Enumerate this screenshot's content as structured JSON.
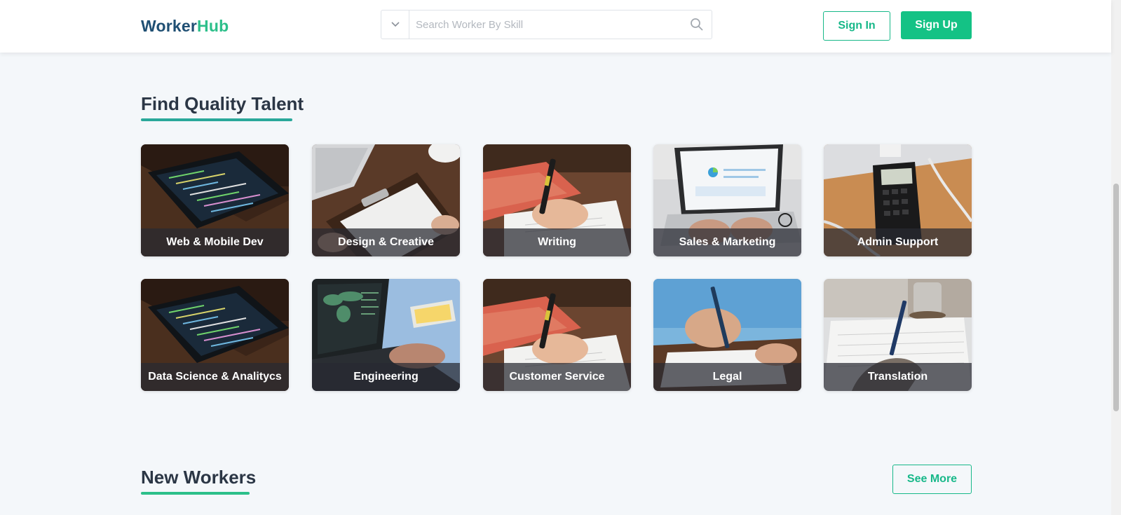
{
  "header": {
    "logo_part1": "Worker",
    "logo_part2": "Hub",
    "search_placeholder": "Search Worker By Skill",
    "signin_label": "Sign In",
    "signup_label": "Sign Up"
  },
  "talent": {
    "title": "Find Quality Talent",
    "categories": [
      {
        "label": "Web & Mobile Dev",
        "image": "phone-code-photo"
      },
      {
        "label": "Design & Creative",
        "image": "clipboard-laptop-photo"
      },
      {
        "label": "Writing",
        "image": "hand-writing-photo"
      },
      {
        "label": "Sales & Marketing",
        "image": "laptop-charts-photo"
      },
      {
        "label": "Admin Support",
        "image": "calculator-desk-photo"
      },
      {
        "label": "Data Science & Analitycs",
        "image": "phone-code-photo"
      },
      {
        "label": "Engineering",
        "image": "laptop-map-photo"
      },
      {
        "label": "Customer Service",
        "image": "hand-writing-photo"
      },
      {
        "label": "Legal",
        "image": "signing-document-photo"
      },
      {
        "label": "Translation",
        "image": "writing-notebook-photo"
      }
    ]
  },
  "new_workers": {
    "title": "New Workers",
    "see_more_label": "See More"
  },
  "colors": {
    "brand_dark": "#1f4f73",
    "brand_green": "#2cbf8a",
    "accent_teal": "#2aa89a",
    "button_green": "#14c285",
    "background": "#f4f7fa"
  }
}
